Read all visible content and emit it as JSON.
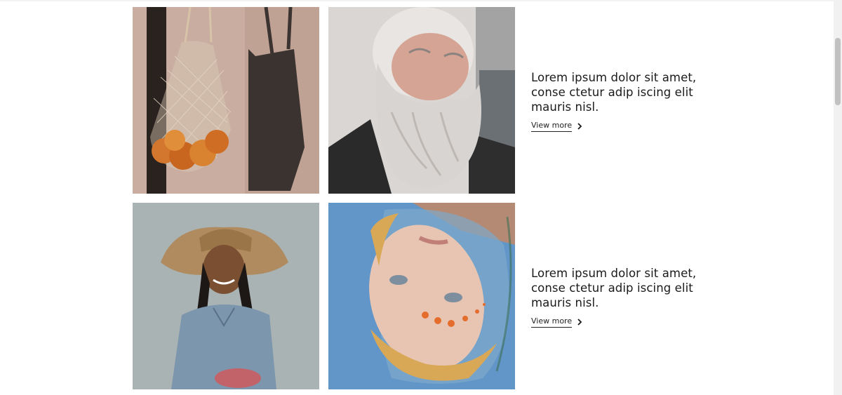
{
  "rows": [
    {
      "images": [
        {
          "name": "mesh-bag-with-oranges-photo"
        },
        {
          "name": "bearded-old-man-photo"
        }
      ],
      "text": "Lorem ipsum dolor sit amet, conse ctetur adip iscing elit mauris nisl.",
      "link_label": "View more",
      "link_icon": "chevron-right-icon"
    },
    {
      "images": [
        {
          "name": "girl-in-straw-hat-photo"
        },
        {
          "name": "woman-reflection-mirror-photo"
        }
      ],
      "text": "Lorem ipsum dolor sit amet, conse ctetur adip iscing elit mauris nisl.",
      "link_label": "View more",
      "link_icon": "chevron-right-icon"
    }
  ],
  "colors": {
    "text": "#1a1a1a",
    "background": "#ffffff"
  }
}
